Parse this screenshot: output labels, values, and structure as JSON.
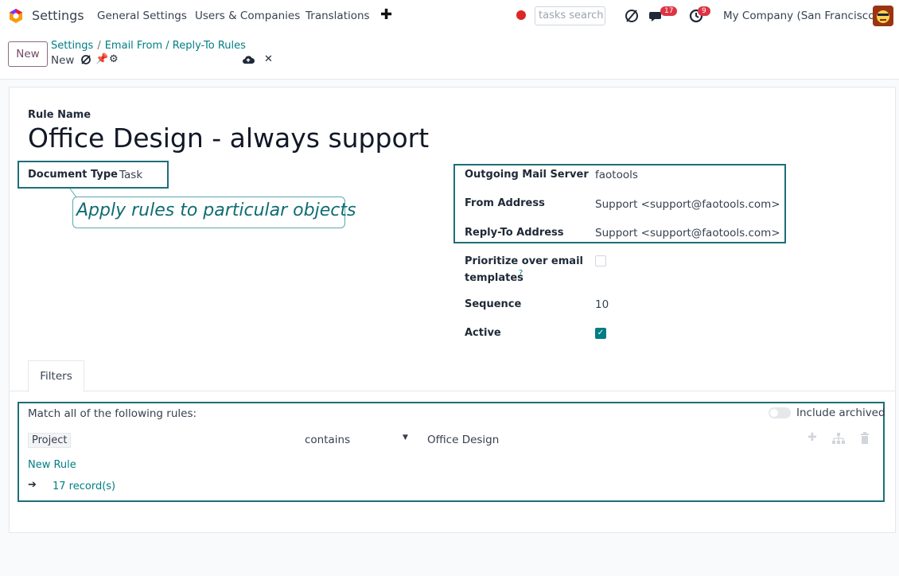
{
  "navbar": {
    "app_name": "Settings",
    "menu": [
      "General Settings",
      "Users & Companies",
      "Translations"
    ],
    "add_icon": "plus-icon",
    "search_placeholder": "tasks search",
    "messages_count": "17",
    "activities_count": "9",
    "company": "My Company (San Francisco)"
  },
  "control_panel": {
    "new_label": "New",
    "breadcrumb": [
      "Settings",
      "Email From / Reply-To Rules"
    ],
    "record_title": "New"
  },
  "form": {
    "rule_name_label": "Rule Name",
    "rule_name": "Office Design - always support",
    "document_type_label": "Document Type",
    "document_type": "Task",
    "callout": "Apply rules to particular objects",
    "outgoing_mail_server_label": "Outgoing Mail Server",
    "outgoing_mail_server": "faotools",
    "from_address_label": "From Address",
    "from_address": "Support <support@faotools.com>",
    "reply_to_label": "Reply-To Address",
    "reply_to": "Support <support@faotools.com>",
    "prioritize_label_line1": "Prioritize over email",
    "prioritize_label_line2": "templates",
    "prioritize_help": "?",
    "prioritize_checked": false,
    "sequence_label": "Sequence",
    "sequence": "10",
    "active_label": "Active",
    "active_checked": true
  },
  "filters": {
    "tab_label": "Filters",
    "match_text": "Match all of the following rules:",
    "include_archived": "Include archived",
    "rule": {
      "field": "Project",
      "operator": "contains",
      "value": "Office Design"
    },
    "new_rule": "New Rule",
    "records": "17 record(s)"
  },
  "colors": {
    "accent": "#017e84",
    "brand": "#714B67",
    "highlight_box": "#1e6e78",
    "badge": "#dc3545"
  }
}
